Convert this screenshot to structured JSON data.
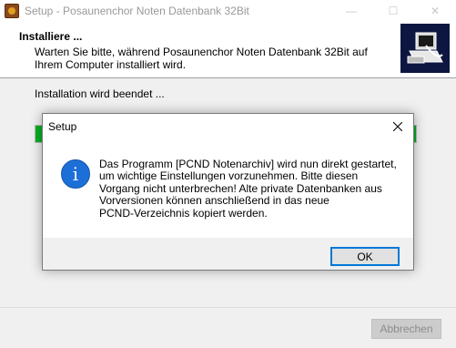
{
  "window": {
    "title": "Setup - Posaunenchor Noten Datenbank 32Bit",
    "minimize_glyph": "—",
    "maximize_glyph": "☐",
    "close_glyph": "✕"
  },
  "header": {
    "title": "Installiere ...",
    "subtitle": "Warten Sie bitte, während Posaunenchor Noten Datenbank 32Bit auf Ihrem Computer installiert wird."
  },
  "main": {
    "status": "Installation wird beendet ...",
    "progress_fraction": 1.0
  },
  "footer": {
    "cancel_label": "Abbrechen"
  },
  "dialog": {
    "title": "Setup",
    "message": "Das Programm [PCND Notenarchiv] wird nun direkt gestartet,\num wichtige Einstellungen vorzunehmen. Bitte diesen\nVorgang nicht unterbrechen! Alte private Datenbanken aus\nVorversionen können anschließend in das neue\nPCND-Verzeichnis kopiert werden.",
    "ok_label": "OK",
    "icon": "info-icon"
  },
  "colors": {
    "accent": "#0078d7",
    "progress": "#06b025",
    "info_icon": "#1d6fd8"
  }
}
